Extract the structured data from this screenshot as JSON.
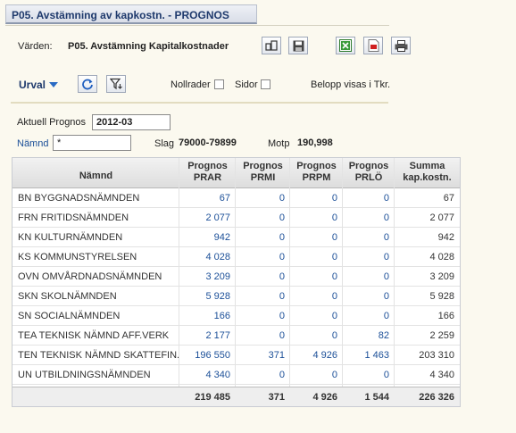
{
  "title": "P05. Avstämning av kapkostn. - PROGNOS",
  "varden_label": "Värden:",
  "varden_value": "P05. Avstämning Kapitalkostnader",
  "urval_label": "Urval",
  "nollrader_label": "Nollrader",
  "sidor_label": "Sidor",
  "belopp_label": "Belopp visas i Tkr.",
  "aktuell_label": "Aktuell Prognos",
  "aktuell_value": "2012-03",
  "namnd_label": "Nämnd",
  "namnd_value": "*",
  "slag_label": "Slag",
  "slag_value": "79000-79899",
  "motp_label": "Motp",
  "motp_value": "190,998",
  "table": {
    "columns": [
      {
        "line1": "Nämnd",
        "line2": ""
      },
      {
        "line1": "Prognos",
        "line2": "PRAR"
      },
      {
        "line1": "Prognos",
        "line2": "PRMI"
      },
      {
        "line1": "Prognos",
        "line2": "PRPM"
      },
      {
        "line1": "Prognos",
        "line2": "PRLÖ"
      },
      {
        "line1": "Summa",
        "line2": "kap.kostn."
      }
    ],
    "rows": [
      {
        "name": "BN BYGGNADSNÄMNDEN",
        "prar": "67",
        "prmi": "0",
        "prpm": "0",
        "prlo": "0",
        "summa": "67"
      },
      {
        "name": "FRN FRITIDSNÄMNDEN",
        "prar": "2 077",
        "prmi": "0",
        "prpm": "0",
        "prlo": "0",
        "summa": "2 077"
      },
      {
        "name": "KN KULTURNÄMNDEN",
        "prar": "942",
        "prmi": "0",
        "prpm": "0",
        "prlo": "0",
        "summa": "942"
      },
      {
        "name": "KS KOMMUNSTYRELSEN",
        "prar": "4 028",
        "prmi": "0",
        "prpm": "0",
        "prlo": "0",
        "summa": "4 028"
      },
      {
        "name": "OVN OMVÅRDNADSNÄMNDEN",
        "prar": "3 209",
        "prmi": "0",
        "prpm": "0",
        "prlo": "0",
        "summa": "3 209"
      },
      {
        "name": "SKN SKOLNÄMNDEN",
        "prar": "5 928",
        "prmi": "0",
        "prpm": "0",
        "prlo": "0",
        "summa": "5 928"
      },
      {
        "name": "SN SOCIALNÄMNDEN",
        "prar": "166",
        "prmi": "0",
        "prpm": "0",
        "prlo": "0",
        "summa": "166"
      },
      {
        "name": "TEA TEKNISK NÄMND AFF.VERK",
        "prar": "2 177",
        "prmi": "0",
        "prpm": "0",
        "prlo": "82",
        "summa": "2 259"
      },
      {
        "name": "TEN TEKNISK NÄMND SKATTEFIN.",
        "prar": "196 550",
        "prmi": "371",
        "prpm": "4 926",
        "prlo": "1 463",
        "summa": "203 310"
      },
      {
        "name": "UN UTBILDNINGSNÄMNDEN",
        "prar": "4 340",
        "prmi": "0",
        "prpm": "0",
        "prlo": "0",
        "summa": "4 340"
      }
    ],
    "totals": {
      "prar": "219 485",
      "prmi": "371",
      "prpm": "4 926",
      "prlo": "1 544",
      "summa": "226 326"
    }
  },
  "colors": {
    "title": "#1f3a6d",
    "link": "#1b4f98",
    "background": "#fbf9ef"
  }
}
